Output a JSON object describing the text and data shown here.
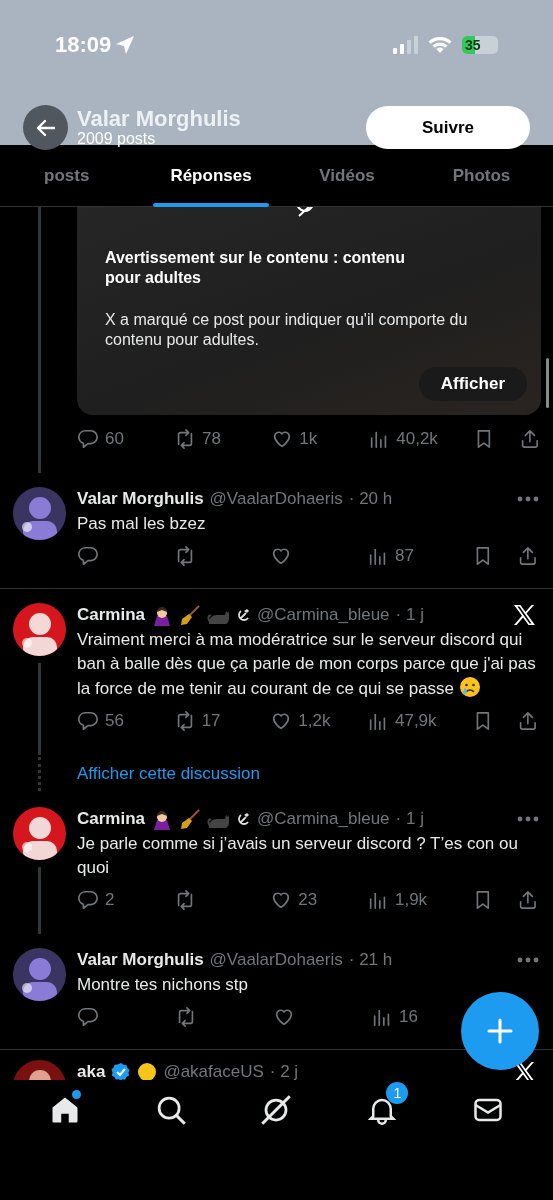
{
  "status_bar": {
    "time": "18:09",
    "battery": "35"
  },
  "header": {
    "name": "Valar Morghulis",
    "posts_count": "2009 posts",
    "follow_button": "Suivre"
  },
  "tabs": [
    {
      "label": "posts",
      "selected": false
    },
    {
      "label": "Réponses",
      "selected": true
    },
    {
      "label": "Vidéos",
      "selected": false
    },
    {
      "label": "Photos",
      "selected": false
    }
  ],
  "feed": [
    {
      "kind": "media_post",
      "thread_above": true,
      "warning": {
        "title": "Avertissement sur le contenu : contenu pour adultes",
        "text": "X a marqué ce post pour indiquer qu'il comporte du contenu pour adultes.",
        "button": "Afficher"
      },
      "stats": {
        "replies": "60",
        "reposts": "78",
        "likes": "1k",
        "views": "40,2k"
      }
    },
    {
      "kind": "post",
      "name": "Valar Morghulis",
      "handle": "@VaalarDohaeris",
      "time": "· 20 h",
      "text": "Pas mal les bzez",
      "crying": false,
      "corner": {
        "kind": "more"
      },
      "thread_below": false,
      "divider": true,
      "stats": {
        "views": "87"
      }
    },
    {
      "kind": "post",
      "name": "Carmina",
      "badges": [
        {
          "kind": "vampire"
        },
        {
          "kind": "broom"
        },
        {
          "kind": "cat"
        },
        {
          "kind": "hammer-sickle"
        }
      ],
      "handle": "@Carmina_bleue",
      "time": "· 1 j",
      "text": "Vraiment merci à ma modératrice sur le serveur discord qui ban à balle dès que ça parle de mon corps parce que j'ai pas la force de me tenir au courant de ce qui se passe",
      "crying": true,
      "corner": {
        "kind": "x-logo"
      },
      "thread_below": true,
      "divider": false,
      "stats": {
        "replies": "56",
        "reposts": "17",
        "likes": "1,2k",
        "views": "47,9k"
      }
    },
    {
      "kind": "thread_link",
      "label": "Afficher cette discussion"
    },
    {
      "kind": "post",
      "name": "Carmina",
      "badges": [
        {
          "kind": "vampire"
        },
        {
          "kind": "broom"
        },
        {
          "kind": "cat"
        },
        {
          "kind": "hammer-sickle"
        }
      ],
      "handle": "@Carmina_bleue",
      "time": "· 1 j",
      "text": "Je parle comme si j’avais un serveur discord ? T’es con ou quoi",
      "crying": false,
      "corner": {
        "kind": "more"
      },
      "thread_below": true,
      "divider": false,
      "stats": {
        "replies": "2",
        "likes": "23",
        "views": "1,9k"
      }
    },
    {
      "kind": "post",
      "name": "Valar Morghulis",
      "handle": "@VaalarDohaeris",
      "time": "· 21 h",
      "text": "Montre tes nichons stp",
      "crying": false,
      "corner": {
        "kind": "more"
      },
      "thread_below": false,
      "divider": true,
      "stats": {
        "views": "16",
        "end_actions": false
      }
    },
    {
      "kind": "partial_post",
      "name": "aka",
      "badges": [
        {
          "kind": "verified"
        },
        {
          "kind": "yellow-circle"
        }
      ],
      "handle": "@akafaceUS",
      "time": "· 2 j",
      "corner": {
        "kind": "x-logo"
      }
    }
  ],
  "nav": [
    {
      "kind": "home",
      "selected": true,
      "dot": true
    },
    {
      "kind": "search",
      "selected": false
    },
    {
      "kind": "grok",
      "selected": false
    },
    {
      "kind": "bell",
      "selected": false,
      "badge": "1"
    },
    {
      "kind": "mail",
      "selected": false
    }
  ]
}
